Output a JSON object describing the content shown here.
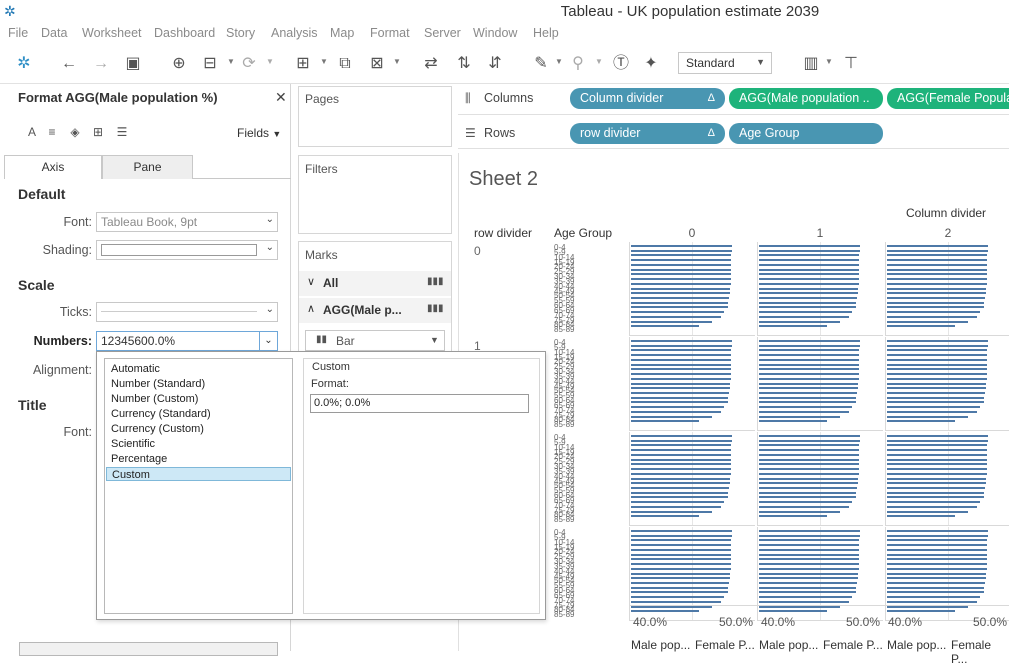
{
  "window": {
    "title": "Tableau - UK population estimate 2039"
  },
  "menu": [
    "File",
    "Data",
    "Worksheet",
    "Dashboard",
    "Story",
    "Analysis",
    "Map",
    "Format",
    "Server",
    "Window",
    "Help"
  ],
  "toolbar": {
    "icons": [
      "tableau-logo",
      "undo-arrow",
      "redo-arrow",
      "save",
      "new-datasource",
      "datasource-paused",
      "refresh",
      "new-worksheet",
      "duplicate-sheet",
      "clear-sheet",
      "swap-axes",
      "sort-ascending",
      "sort-descending",
      "highlight",
      "paperclip",
      "text-label",
      "pin",
      "show-me",
      "presentation"
    ],
    "view_mode": "Standard"
  },
  "format_pane": {
    "title": "Format AGG(Male population %)",
    "fields_label": "Fields",
    "tabs": [
      "Axis",
      "Pane"
    ],
    "active_tab": "Axis",
    "sections": {
      "default": "Default",
      "scale": "Scale",
      "title": "Title"
    },
    "labels": {
      "font": "Font:",
      "shading": "Shading:",
      "ticks": "Ticks:",
      "numbers": "Numbers:",
      "alignment": "Alignment:",
      "title_font": "Font:"
    },
    "font_value": "Tableau Book, 9pt",
    "numbers_value": "12345600.0%",
    "number_formats": [
      "Automatic",
      "Number (Standard)",
      "Number (Custom)",
      "Currency (Standard)",
      "Currency (Custom)",
      "Scientific",
      "Percentage",
      "Custom"
    ],
    "selected_format": "Custom",
    "custom_heading": "Custom",
    "format_label": "Format:",
    "format_value": "0.0%; 0.0%"
  },
  "cards": {
    "pages": "Pages",
    "filters": "Filters",
    "marks": "Marks",
    "marks_all": "All",
    "marks_measure": "AGG(Male p...",
    "mark_type": "Bar"
  },
  "shelves": {
    "columns_label": "Columns",
    "rows_label": "Rows",
    "columns_pills": [
      "Column divider",
      "AGG(Male population ..",
      "AGG(Female Popula"
    ],
    "rows_pills": [
      "row divider",
      "Age Group"
    ]
  },
  "view": {
    "sheet_title": "Sheet 2",
    "column_divider_title": "Column divider",
    "row_header": "row divider",
    "age_header": "Age Group",
    "column_values": [
      "0",
      "1",
      "2"
    ],
    "row_values": [
      "0",
      "1"
    ],
    "age_labels_top": [
      "0-4",
      "5-9",
      "10-14",
      "15-19",
      "20-24",
      "25-29",
      "30-34",
      "35-39",
      "40-44",
      "45-49",
      "50-54",
      "55-59",
      "60-64",
      "65-69",
      "70-74",
      "75-79",
      "80-84",
      "85-89"
    ],
    "axis_ticks": [
      "40.0%",
      "50.0%",
      "40.0%",
      "50.0%",
      "40.0%",
      "50.0%"
    ],
    "axis_titles": [
      "Male pop...",
      "Female P...",
      "Male pop...",
      "Female P...",
      "Male pop...",
      "Female P..."
    ],
    "colors": {
      "bar": "#4e79a7",
      "pill_dimension": "#4996b2",
      "pill_measure": "#1eb37b"
    }
  },
  "chart_data": {
    "type": "bar",
    "categories": [
      "0-4",
      "5-9",
      "10-14",
      "15-19",
      "20-24",
      "25-29",
      "30-34",
      "35-39",
      "40-44",
      "45-49",
      "50-54",
      "55-59",
      "60-64",
      "65-69",
      "70-74",
      "75-79",
      "80-84",
      "85-89"
    ],
    "xlabel": "Male pop...",
    "xticks": [
      "40.0%",
      "50.0%"
    ],
    "xlim": [
      0.35,
      0.55
    ],
    "series": [
      {
        "values": [
          0.513,
          0.513,
          0.512,
          0.512,
          0.512,
          0.512,
          0.511,
          0.511,
          0.511,
          0.51,
          0.509,
          0.508,
          0.507,
          0.506,
          0.5,
          0.495,
          0.48,
          0.46
        ]
      }
    ]
  }
}
